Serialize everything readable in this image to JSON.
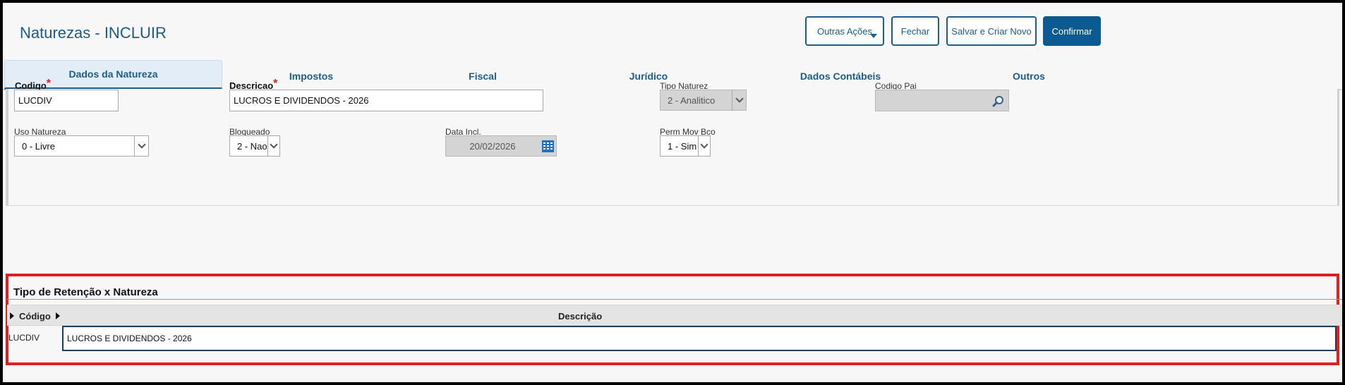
{
  "header": {
    "title": "Naturezas - INCLUIR",
    "buttons": {
      "outras_acoes": "Outras Ações",
      "fechar": "Fechar",
      "salvar_criar": "Salvar e Criar Novo",
      "confirmar": "Confirmar"
    }
  },
  "tabs": [
    {
      "label": "Dados da Natureza",
      "active": true
    },
    {
      "label": "Impostos",
      "active": false
    },
    {
      "label": "Fiscal",
      "active": false
    },
    {
      "label": "Jurídico",
      "active": false
    },
    {
      "label": "Dados Contábeis",
      "active": false
    },
    {
      "label": "Outros",
      "active": false
    }
  ],
  "form": {
    "codigo": {
      "label": "Codigo",
      "value": "LUCDIV",
      "required_mark": "*"
    },
    "descricao": {
      "label": "Descricao",
      "value": "LUCROS E DIVIDENDOS - 2026",
      "required_mark": "*"
    },
    "tipo_natureza": {
      "label": "Tipo Naturez",
      "value": "2 - Analitico"
    },
    "codigo_pai": {
      "label": "Codigo Pai",
      "value": ""
    },
    "uso_natureza": {
      "label": "Uso Natureza",
      "value": "0 - Livre"
    },
    "bloqueado": {
      "label": "Bloqueado",
      "value": "2 - Nao"
    },
    "data_incl": {
      "label": "Data Incl.",
      "value": "20/02/2026"
    },
    "perm_mov_bco": {
      "label": "Perm Mov Bco",
      "value": "1 - Sim"
    }
  },
  "grid": {
    "title": "Tipo de Retenção x Natureza",
    "columns": [
      "Código",
      "Descrição"
    ],
    "rows": [
      {
        "codigo": "LUCDIV",
        "descricao": "LUCROS E DIVIDENDOS - 2026"
      }
    ]
  },
  "colors": {
    "accent": "#1c5d8c",
    "primary_button": "#0b5a92",
    "highlight_box": "#e01f1f"
  }
}
